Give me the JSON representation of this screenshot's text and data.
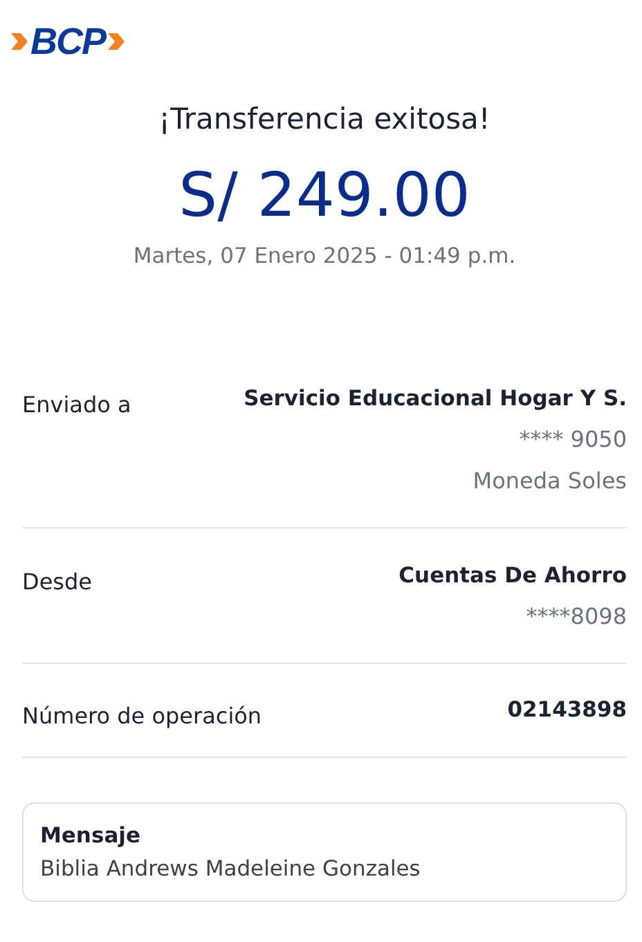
{
  "logo": {
    "text": "BCP"
  },
  "title": "¡Transferencia exitosa!",
  "amount": "S/ 249.00",
  "date": "Martes, 07 Enero 2025 - 01:49 p.m.",
  "details": [
    {
      "label": "Enviado a",
      "title": "Servicio Educacional Hogar Y S.",
      "lines": [
        "**** 9050",
        "Moneda Soles"
      ]
    },
    {
      "label": "Desde",
      "title": "Cuentas De Ahorro",
      "lines": [
        "****8098"
      ]
    },
    {
      "label": "Número de operación",
      "title": "02143898"
    }
  ],
  "message": {
    "label": "Mensaje",
    "text": "Biblia Andrews Madeleine Gonzales"
  }
}
